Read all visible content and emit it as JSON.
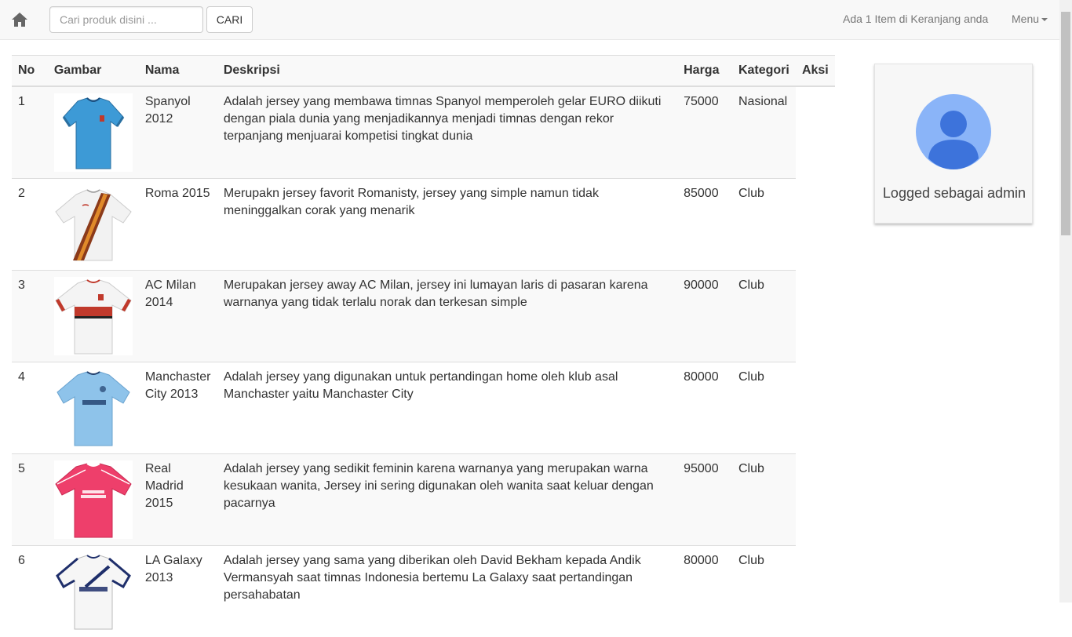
{
  "navbar": {
    "search_placeholder": "Cari produk disini ...",
    "search_button": "CARI",
    "cart_text": "Ada 1 Item di Keranjang anda",
    "menu_label": "Menu"
  },
  "table": {
    "headers": [
      "No",
      "Gambar",
      "Nama",
      "Deskripsi",
      "Harga",
      "Kategori",
      "Aksi"
    ],
    "rows": [
      {
        "no": "1",
        "nama": "Spanyol 2012",
        "deskripsi": "Adalah jersey yang membawa timnas Spanyol memperoleh gelar EURO diikuti dengan piala dunia yang menjadikannya menjadi timnas dengan rekor terpanjang menjuarai kompetisi tingkat dunia",
        "harga": "75000",
        "kategori": "Nasional",
        "image": "blue-jersey"
      },
      {
        "no": "2",
        "nama": "Roma 2015",
        "deskripsi": "Merupakn jersey favorit Romanisty, jersey yang simple namun tidak meninggalkan corak yang menarik",
        "harga": "85000",
        "kategori": "Club",
        "image": "white-sash-jersey"
      },
      {
        "no": "3",
        "nama": "AC Milan 2014",
        "deskripsi": "Merupakan jersey away AC Milan, jersey ini lumayan laris di pasaran karena warnanya yang tidak terlalu norak dan terkesan simple",
        "harga": "90000",
        "kategori": "Club",
        "image": "white-red-jersey"
      },
      {
        "no": "4",
        "nama": "Manchaster City 2013",
        "deskripsi": "Adalah jersey yang digunakan untuk pertandingan home oleh klub asal Manchaster yaitu Manchaster City",
        "harga": "80000",
        "kategori": "Club",
        "image": "sky-blue-jersey"
      },
      {
        "no": "5",
        "nama": "Real Madrid 2015",
        "deskripsi": "Adalah jersey yang sedikit feminin karena warnanya yang merupakan warna kesukaan wanita, Jersey ini sering digunakan oleh wanita saat keluar dengan pacarnya",
        "harga": "95000",
        "kategori": "Club",
        "image": "pink-jersey"
      },
      {
        "no": "6",
        "nama": "LA Galaxy 2013",
        "deskripsi": "Adalah jersey yang sama yang diberikan oleh David Bekham kepada Andik Vermansyah saat timnas Indonesia bertemu La Galaxy saat pertandingan persahabatan",
        "harga": "80000",
        "kategori": "Club",
        "image": "white-navy-jersey"
      }
    ]
  },
  "admin_card": {
    "text": "Logged sebagai admin",
    "icon": "user-avatar-icon"
  },
  "colors": {
    "navbar_bg": "#f8f8f8",
    "avatar_bg": "#8ab4f8",
    "avatar_fg": "#3d73db"
  }
}
